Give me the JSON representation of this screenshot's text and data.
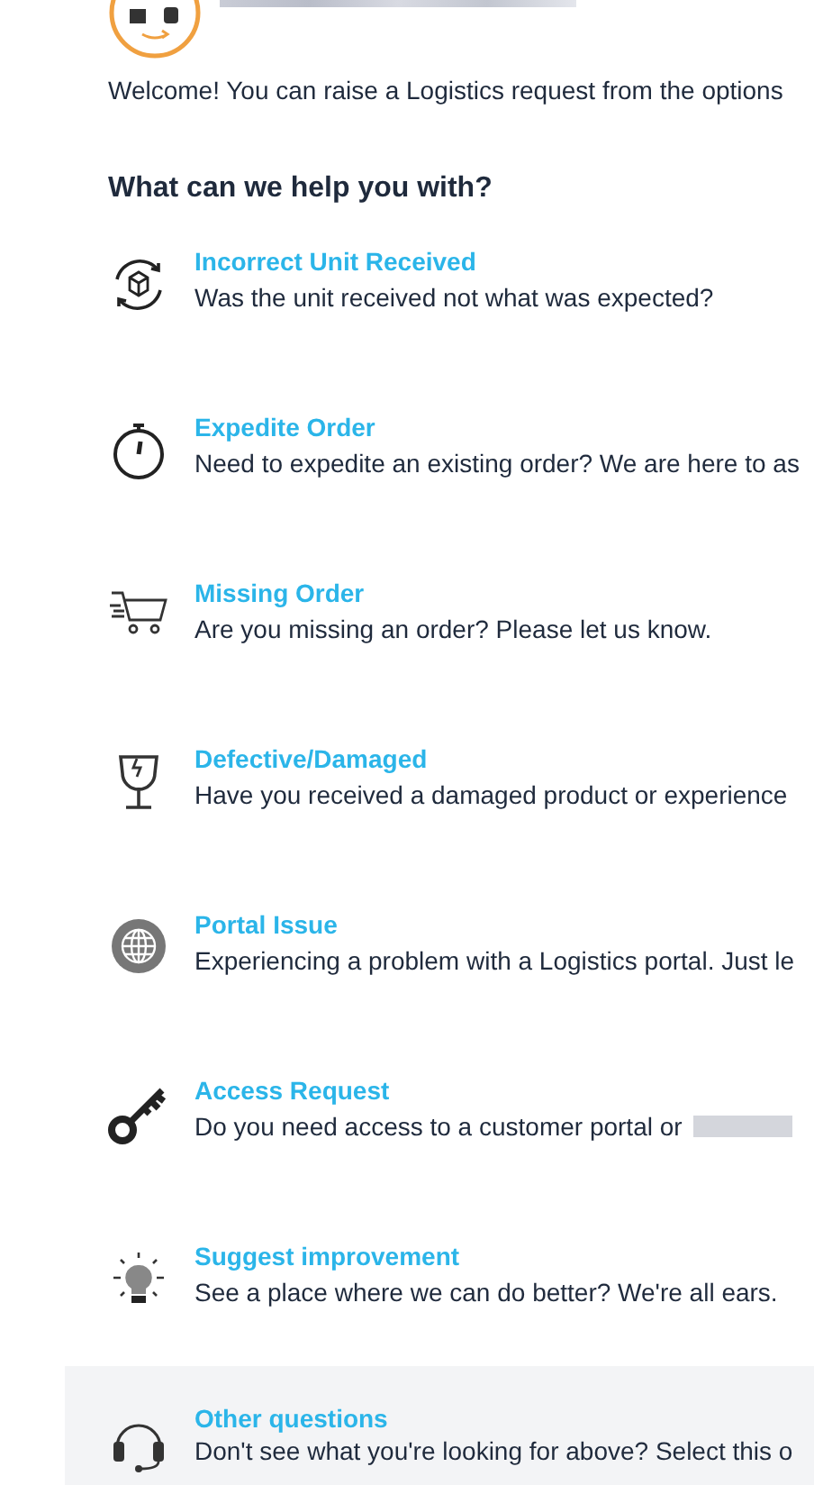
{
  "welcome": "Welcome! You can raise a Logistics request from the options",
  "heading": "What can we help you with?",
  "options": [
    {
      "kind": "cycle",
      "title": "Incorrect Unit Received",
      "description": "Was the unit received not what was expected?",
      "selected": false
    },
    {
      "kind": "stopwatch",
      "title": "Expedite Order",
      "description": "Need to expedite an existing order? We are here to as",
      "selected": false
    },
    {
      "kind": "cart",
      "title": "Missing Order",
      "description": "Are you missing an order? Please let us know.",
      "selected": false
    },
    {
      "kind": "glass",
      "title": "Defective/Damaged",
      "description": "Have you received a damaged product or experience",
      "selected": false
    },
    {
      "kind": "globe",
      "title": "Portal Issue",
      "description": "Experiencing a problem with a Logistics portal. Just le",
      "selected": false
    },
    {
      "kind": "key",
      "title": "Access Request",
      "description": "Do you need access to a customer portal or",
      "redacted": true,
      "selected": false
    },
    {
      "kind": "bulb",
      "title": "Suggest improvement",
      "description": "See a place where we can do better? We're all ears.",
      "selected": false
    },
    {
      "kind": "headset",
      "title": "Other questions",
      "description": "Don't see what you're looking for above? Select this o",
      "selected": true
    }
  ]
}
